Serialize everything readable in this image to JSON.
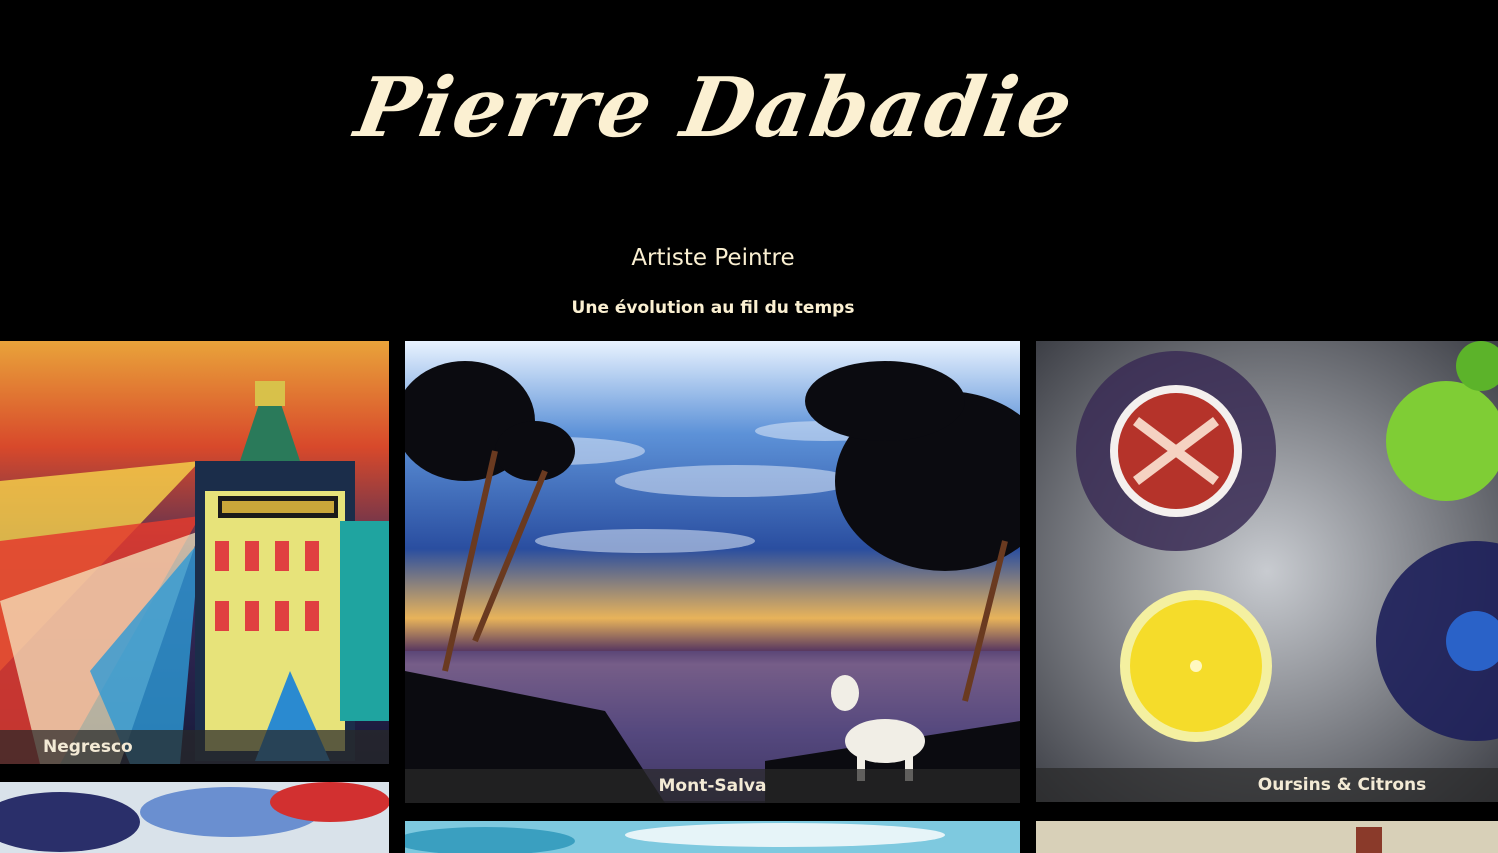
{
  "header": {
    "title": "Pierre Dabadie",
    "subtitle": "Artiste Peintre",
    "tagline": "Une évolution au fil du temps"
  },
  "gallery": [
    {
      "caption": "Negresco"
    },
    {
      "caption": "Mont-Salva"
    },
    {
      "caption": "Oursins & Citrons"
    }
  ],
  "colors": {
    "background": "#000000",
    "title": "#fbf0d2",
    "caption_bg": "#282828",
    "caption_text": "#f3ead5"
  }
}
